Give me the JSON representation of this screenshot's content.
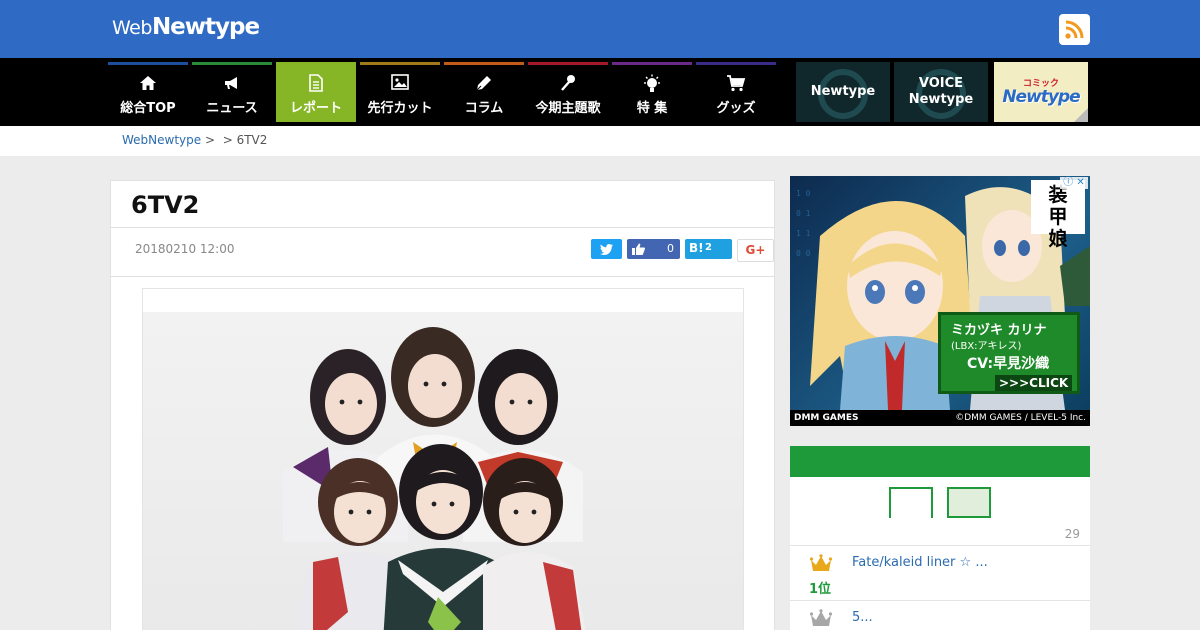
{
  "header": {
    "logo_web": "Web",
    "logo_newtype": "Newtype",
    "rss_icon": "rss-icon"
  },
  "nav": [
    {
      "label": "総合TOP",
      "icon": "home-icon",
      "color": "#1e4f9e"
    },
    {
      "label": "ニュース",
      "icon": "megaphone-icon",
      "color": "#2b8a3a"
    },
    {
      "label": "レポート",
      "icon": "document-icon",
      "color": "#86b625",
      "active": true
    },
    {
      "label": "先行カット",
      "icon": "image-icon",
      "color": "#a07a1a"
    },
    {
      "label": "コラム",
      "icon": "pen-icon",
      "color": "#c25a1a"
    },
    {
      "label": "今期主題歌",
      "icon": "microphone-icon",
      "color": "#a01a2a"
    },
    {
      "label": "特 集",
      "icon": "lightbulb-icon",
      "color": "#6a2a8a"
    },
    {
      "label": "グッズ",
      "icon": "cart-icon",
      "color": "#3a2a8a"
    }
  ],
  "promos": {
    "newtype": "Newtype",
    "voice_line1": "VOICE",
    "voice_line2": "Newtype",
    "comic_small": "コミック",
    "comic_main": "Newtype"
  },
  "breadcrumb": {
    "home": "WebNewtype",
    "sep1": ">",
    "middle": "",
    "sep2": ">",
    "current": "6TV2"
  },
  "article": {
    "title": "6TV2",
    "date": "20180210 12:00",
    "share": {
      "facebook_count": "0",
      "hatena_label": "B!",
      "hatena_count": "2",
      "gplus_label": "G+"
    }
  },
  "ad": {
    "logo": "装甲娘",
    "info": "ⓘ ✕",
    "name": "ミカヅキ カリナ",
    "sub": "(LBX:アキレス)",
    "cv": "CV:早見沙織",
    "cta": ">>>CLICK",
    "footer_left": "DMM GAMES",
    "footer_right": "©DMM GAMES / LEVEL-5 Inc."
  },
  "ranking": {
    "count": "29",
    "items": [
      {
        "position": "1位",
        "title": "Fate/kaleid liner ☆ ..."
      },
      {
        "position": "",
        "title": "5..."
      }
    ]
  },
  "colors": {
    "topbar": "#2f6bc4",
    "active_nav": "#86b625",
    "ranking_green": "#1f9a3b",
    "link": "#2a6bb0"
  }
}
